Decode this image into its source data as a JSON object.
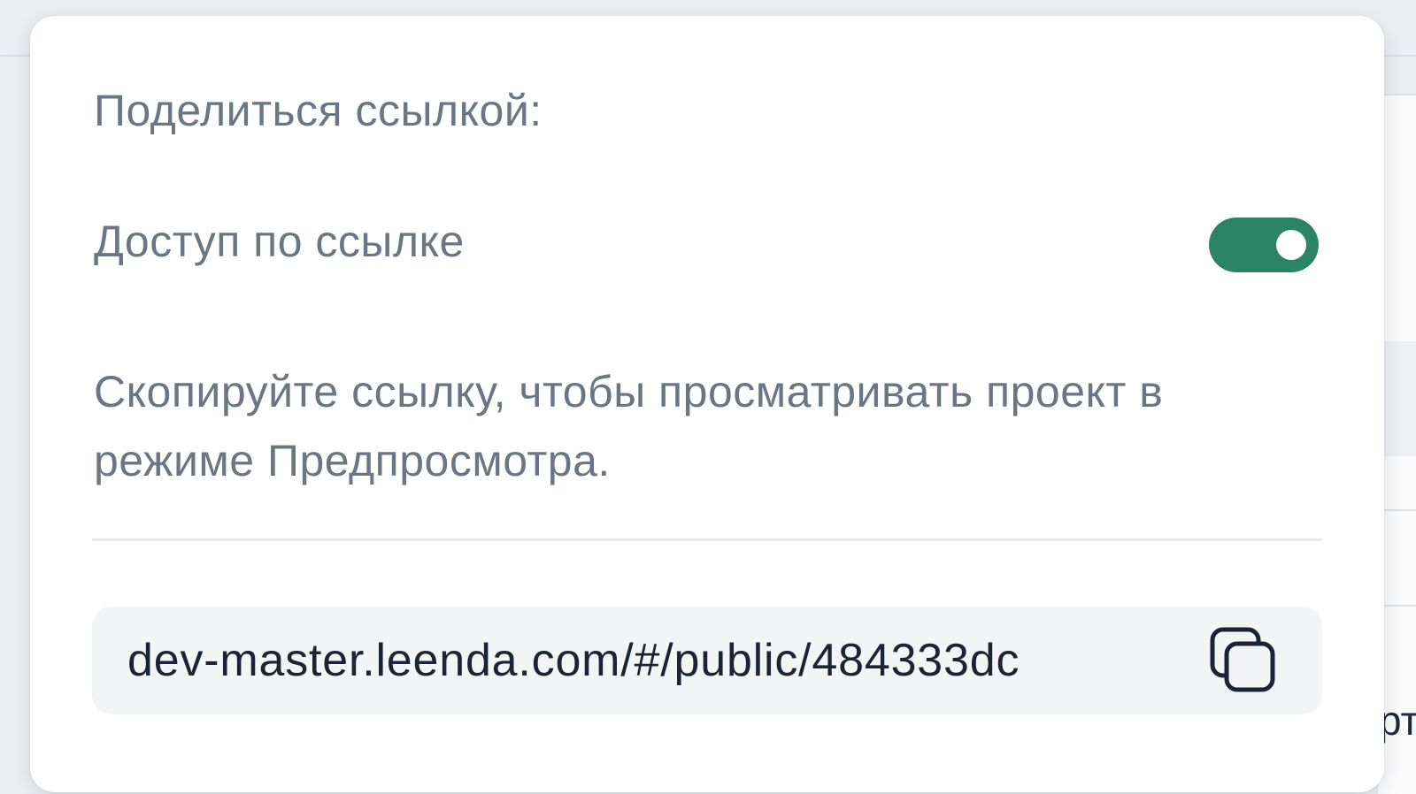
{
  "share_popover": {
    "title": "Поделиться ссылкой:",
    "access_toggle": {
      "label": "Доступ по ссылке",
      "enabled": true,
      "color": "#2b8465"
    },
    "description": "Скопируйте ссылку, чтобы просматривать проект в режиме Предпросмотра.",
    "link": {
      "value": "dev-master.leenda.com/#/public/484333dc",
      "copy_icon": "copy-icon"
    }
  },
  "background": {
    "peek_text": "рт"
  }
}
